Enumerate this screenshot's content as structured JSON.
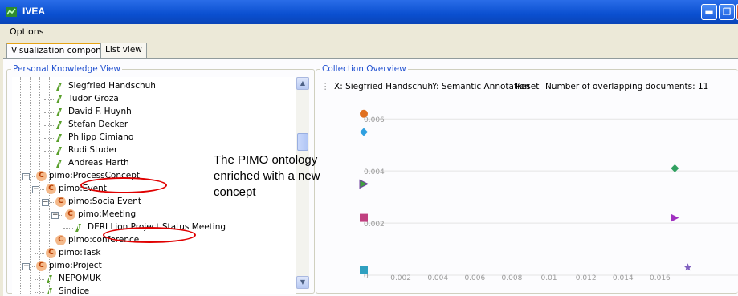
{
  "window": {
    "title": "IVEA"
  },
  "menu": {
    "options": "Options"
  },
  "tabs": [
    {
      "label": "Visualization components",
      "active": true
    },
    {
      "label": "List view",
      "active": false
    }
  ],
  "left_panel": {
    "title": "Personal Knowledge View",
    "tree": [
      {
        "label": "Siegfried Handschuh",
        "type": "instance",
        "depth": 3
      },
      {
        "label": "Tudor Groza",
        "type": "instance",
        "depth": 3
      },
      {
        "label": "David F. Huynh",
        "type": "instance",
        "depth": 3
      },
      {
        "label": "Stefan Decker",
        "type": "instance",
        "depth": 3
      },
      {
        "label": "Philipp Cimiano",
        "type": "instance",
        "depth": 3
      },
      {
        "label": "Rudi Studer",
        "type": "instance",
        "depth": 3
      },
      {
        "label": "Andreas Harth",
        "type": "instance",
        "depth": 3
      },
      {
        "label": "pimo:ProcessConcept",
        "type": "class",
        "depth": 1,
        "expanded": true
      },
      {
        "label": "pimo:Event",
        "type": "class",
        "depth": 2,
        "expanded": true,
        "highlighted": true
      },
      {
        "label": "pimo:SocialEvent",
        "type": "class",
        "depth": 3,
        "expanded": true
      },
      {
        "label": "pimo:Meeting",
        "type": "class",
        "depth": 4,
        "expanded": true
      },
      {
        "label": "DERI Lion Project Status Meeting",
        "type": "instance",
        "depth": 5
      },
      {
        "label": "pimo:conference",
        "type": "class",
        "depth": 3,
        "highlighted": true
      },
      {
        "label": "pimo:Task",
        "type": "class",
        "depth": 2
      },
      {
        "label": "pimo:Project",
        "type": "class",
        "depth": 1,
        "expanded": true
      },
      {
        "label": "NEPOMUK",
        "type": "instance",
        "depth": 2
      },
      {
        "label": "Sindice",
        "type": "instance",
        "depth": 2
      }
    ]
  },
  "annotation": {
    "lines": [
      "The PIMO ontology",
      "enriched with a new",
      "concept"
    ]
  },
  "right_panel": {
    "title": "Collection Overview",
    "toolbar": {
      "x": "X: Siegfried Handschuh",
      "y": "Y: Semantic Annotation",
      "reset": "Reset",
      "overlap": "Number of overlapping documents: 11"
    }
  },
  "chart_data": {
    "type": "scatter",
    "x_ticks": [
      "0.002",
      "0.004",
      "0.006",
      "0.008",
      "0.01",
      "0.012",
      "0.014",
      "0.016"
    ],
    "y_ticks": [
      "0.006",
      "0.004",
      "0.002",
      "0"
    ],
    "xlim": [
      0,
      0.018
    ],
    "ylim": [
      0,
      0.0065
    ],
    "grid": "horizontal",
    "points": [
      {
        "x": 0.0,
        "y": 0.0062,
        "shape": "circle",
        "color": "#e07020"
      },
      {
        "x": 0.0,
        "y": 0.0055,
        "shape": "diamond",
        "color": "#30a0e0"
      },
      {
        "x": 0.0,
        "y": 0.0035,
        "shape": "flag",
        "color": "#40a040"
      },
      {
        "x": 0.0,
        "y": 0.0022,
        "shape": "square",
        "color": "#c04080"
      },
      {
        "x": 0.0,
        "y": 0.0002,
        "shape": "square",
        "color": "#30a0c0"
      },
      {
        "x": 0.0168,
        "y": 0.0041,
        "shape": "diamond",
        "color": "#30a060"
      },
      {
        "x": 0.0168,
        "y": 0.0022,
        "shape": "triangle",
        "color": "#a030c0"
      },
      {
        "x": 0.0175,
        "y": 0.0003,
        "shape": "star",
        "color": "#8060c0"
      }
    ]
  }
}
